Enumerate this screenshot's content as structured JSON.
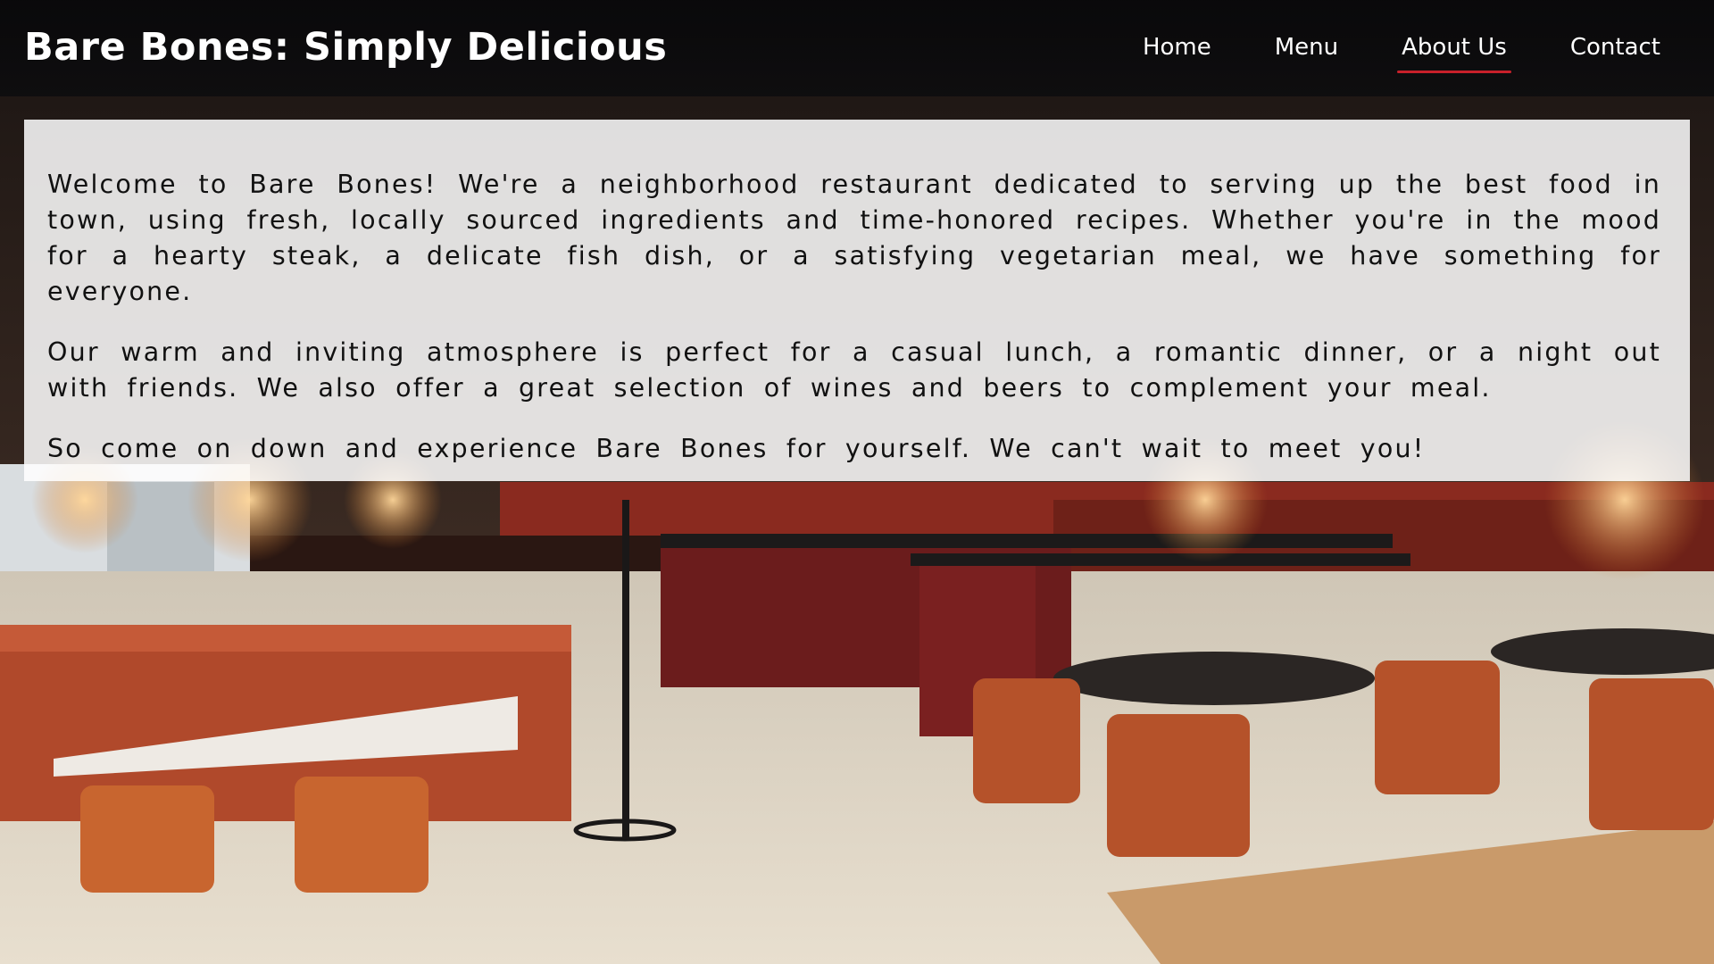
{
  "header": {
    "brand": "Bare Bones: Simply Delicious",
    "nav": [
      {
        "label": "Home",
        "active": false
      },
      {
        "label": "Menu",
        "active": false
      },
      {
        "label": "About Us",
        "active": true
      },
      {
        "label": "Contact",
        "active": false
      }
    ]
  },
  "about": {
    "paragraphs": [
      "Welcome to Bare Bones! We're a neighborhood restaurant dedicated to serving up the best food in town, using fresh, locally sourced ingredients and time-honored recipes. Whether you're in the mood for a hearty steak, a delicate fish dish, or a satisfying vegetarian meal, we have something for everyone.",
      "Our warm and inviting atmosphere is perfect for a casual lunch, a romantic dinner, or a night out with friends. We also offer a great selection of wines and beers to complement your meal.",
      "So come on down and experience Bare Bones for yourself. We can't wait to meet you!"
    ]
  },
  "colors": {
    "active_underline": "#c8202a",
    "header_bg": "#0c0c0e",
    "panel_bg": "#ffffff"
  }
}
